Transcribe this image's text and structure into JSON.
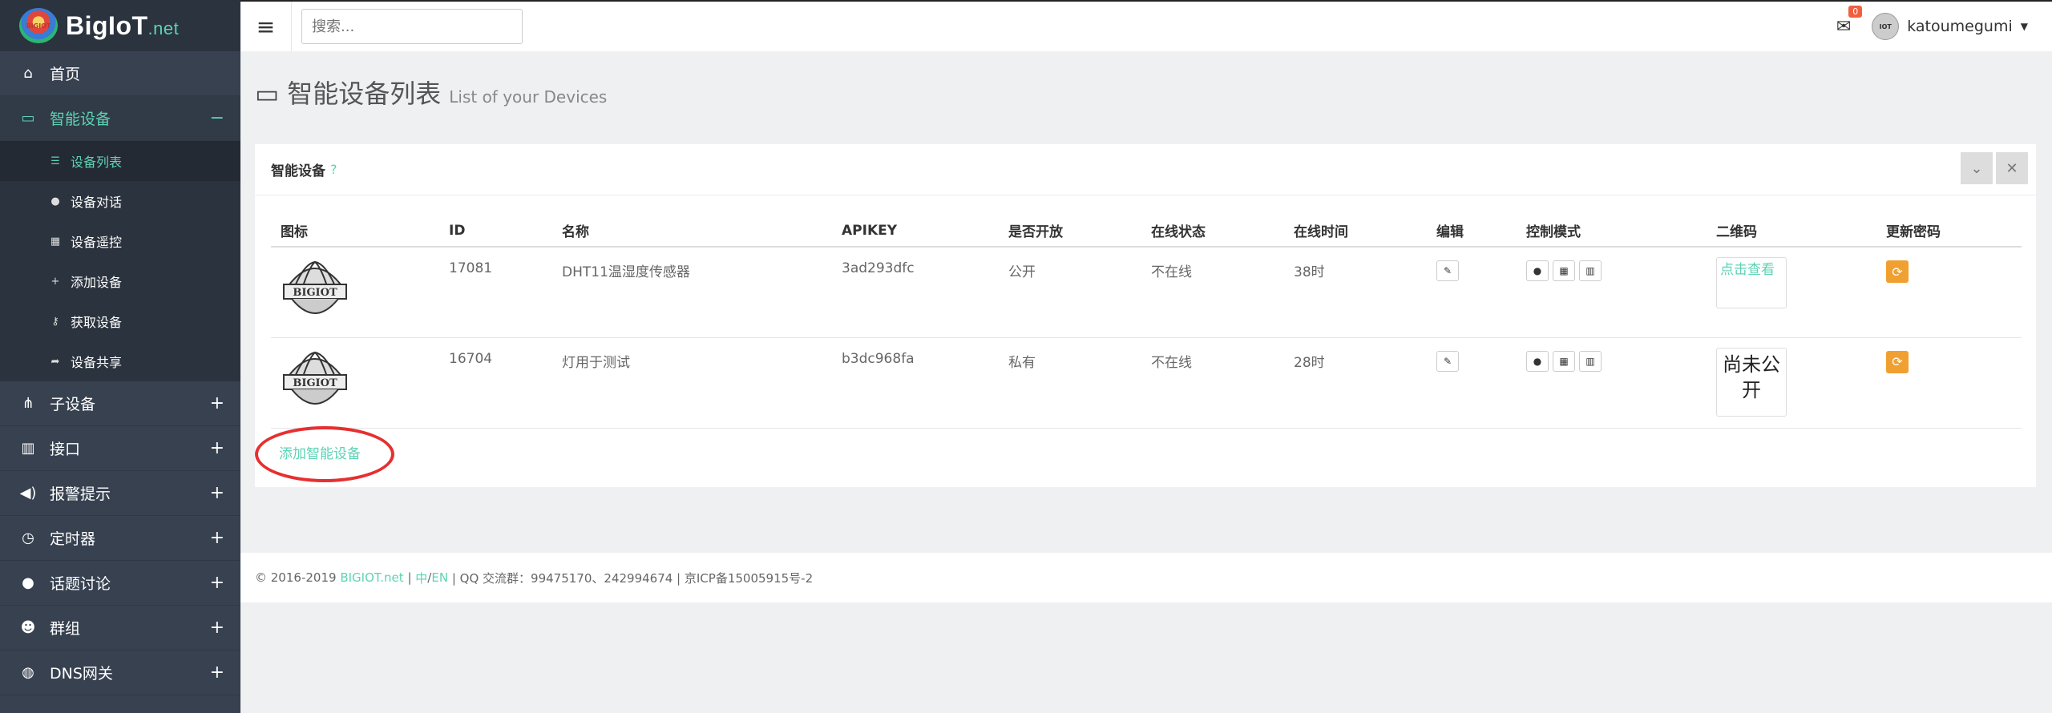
{
  "brand": {
    "logo_text": "BigIoT",
    "logo_suffix": ".net",
    "logo_mark": "BIGIOT"
  },
  "search": {
    "placeholder": "搜索..."
  },
  "user": {
    "name": "katoumegumi",
    "mail_badge": "0"
  },
  "sidebar": {
    "items": [
      {
        "label": "首页",
        "icon": "home-icon",
        "sign": ""
      },
      {
        "label": "智能设备",
        "icon": "laptop-icon",
        "sign": "−"
      },
      {
        "label": "子设备",
        "icon": "sitemap-icon",
        "sign": "+"
      },
      {
        "label": "接口",
        "icon": "chart-icon",
        "sign": "+"
      },
      {
        "label": "报警提示",
        "icon": "volume-icon",
        "sign": "+"
      },
      {
        "label": "定时器",
        "icon": "clock-icon",
        "sign": "+"
      },
      {
        "label": "话题讨论",
        "icon": "comments-icon",
        "sign": "+"
      },
      {
        "label": "群组",
        "icon": "users-icon",
        "sign": "+"
      },
      {
        "label": "DNS网关",
        "icon": "globe-icon",
        "sign": "+"
      }
    ],
    "subitems": [
      {
        "label": "设备列表"
      },
      {
        "label": "设备对话"
      },
      {
        "label": "设备遥控"
      },
      {
        "label": "添加设备"
      },
      {
        "label": "获取设备"
      },
      {
        "label": "设备共享"
      }
    ]
  },
  "page": {
    "title": "智能设备列表",
    "subtitle": "List of your Devices"
  },
  "panel": {
    "title": "智能设备",
    "help": "?",
    "columns": [
      "图标",
      "ID",
      "名称",
      "APIKEY",
      "是否开放",
      "在线状态",
      "在线时间",
      "编辑",
      "控制模式",
      "二维码",
      "更新密码"
    ],
    "rows": [
      {
        "icon_text": "BIGIOT",
        "id": "17081",
        "name": "DHT11温湿度传感器",
        "apikey": "3ad293dfc",
        "open": "公开",
        "status": "不在线",
        "time": "38时",
        "qr": "点击查看"
      },
      {
        "icon_text": "BIGIOT",
        "id": "16704",
        "name": "灯用于测试",
        "apikey": "b3dc968fa",
        "open": "私有",
        "status": "不在线",
        "time": "28时",
        "qr": "尚未公开"
      }
    ],
    "add_link": "添加智能设备"
  },
  "footer": {
    "copyright": "© 2016-2019",
    "site": "BIGIOT.net",
    "sep1": "|",
    "lang_zh": "中",
    "lang_slash": "/",
    "lang_en": "EN",
    "rest": "| QQ 交流群：99475170、242994674 | 京ICP备15005915号-2"
  },
  "colors": {
    "accent": "#5cd3b4",
    "sidebar": "#374150",
    "warn": "#f0a030",
    "highlight": "#e53030"
  }
}
